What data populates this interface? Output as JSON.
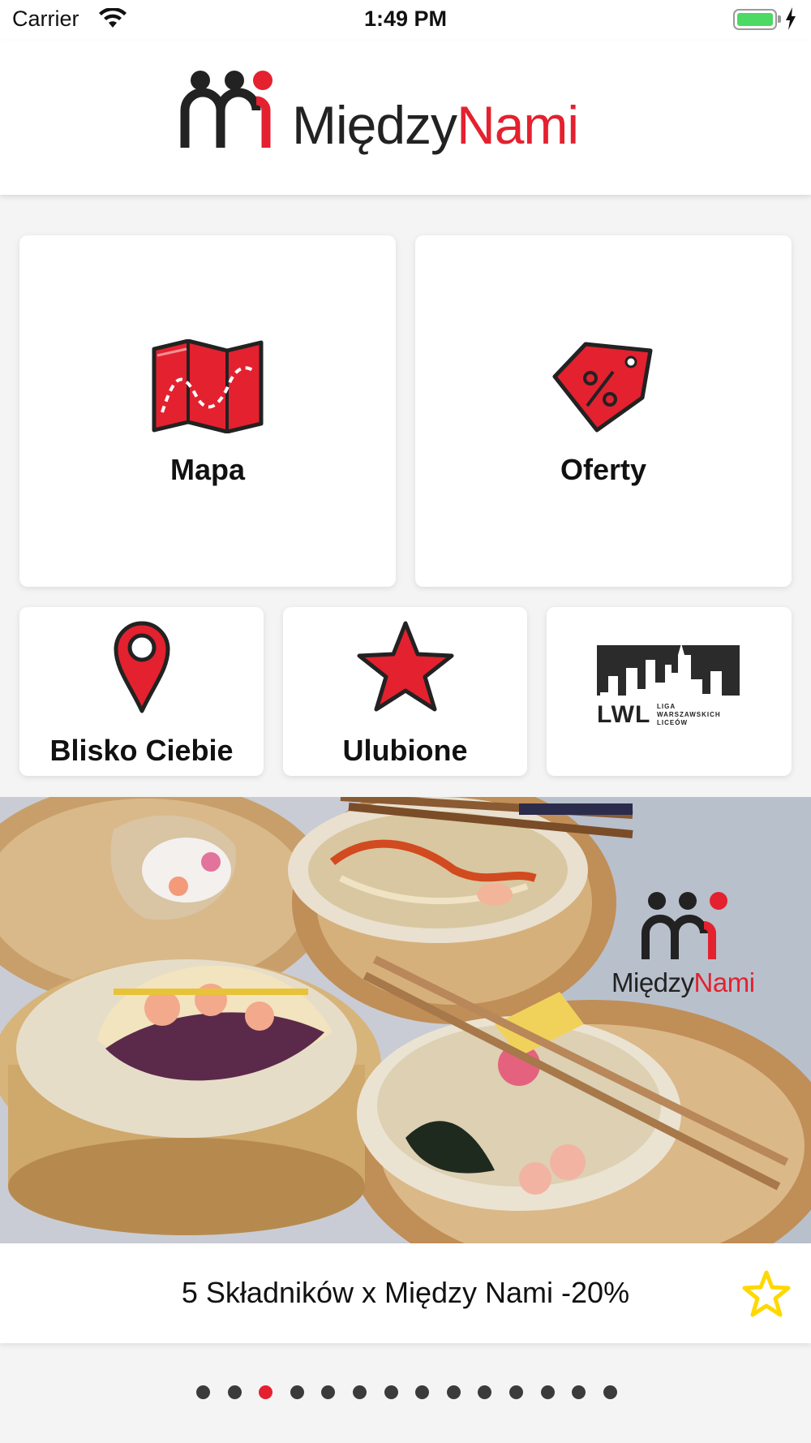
{
  "status_bar": {
    "carrier": "Carrier",
    "time": "1:49 PM",
    "battery_color": "#4cd964"
  },
  "header": {
    "logo_text_dark": "Między",
    "logo_text_red": "Nami",
    "brand_red": "#e4212f"
  },
  "tiles": {
    "mapa": {
      "label": "Mapa",
      "icon": "map-icon"
    },
    "oferty": {
      "label": "Oferty",
      "icon": "discount-tag-icon"
    },
    "blisko": {
      "label": "Blisko Ciebie",
      "icon": "location-pin-icon"
    },
    "ulubione": {
      "label": "Ulubione",
      "icon": "star-icon"
    },
    "lwl": {
      "abbr": "LWL",
      "line1": "LIGA",
      "line2": "WARSZAWSKICH",
      "line3": "LICEÓW"
    }
  },
  "banner": {
    "logo_text_dark": "Między",
    "logo_text_red": "Nami",
    "caption": "5 Składników x Między Nami -20%",
    "favorite_icon": "star-outline-icon",
    "favorite_color": "#ffd800"
  },
  "pagination": {
    "count": 14,
    "active_index": 2
  }
}
